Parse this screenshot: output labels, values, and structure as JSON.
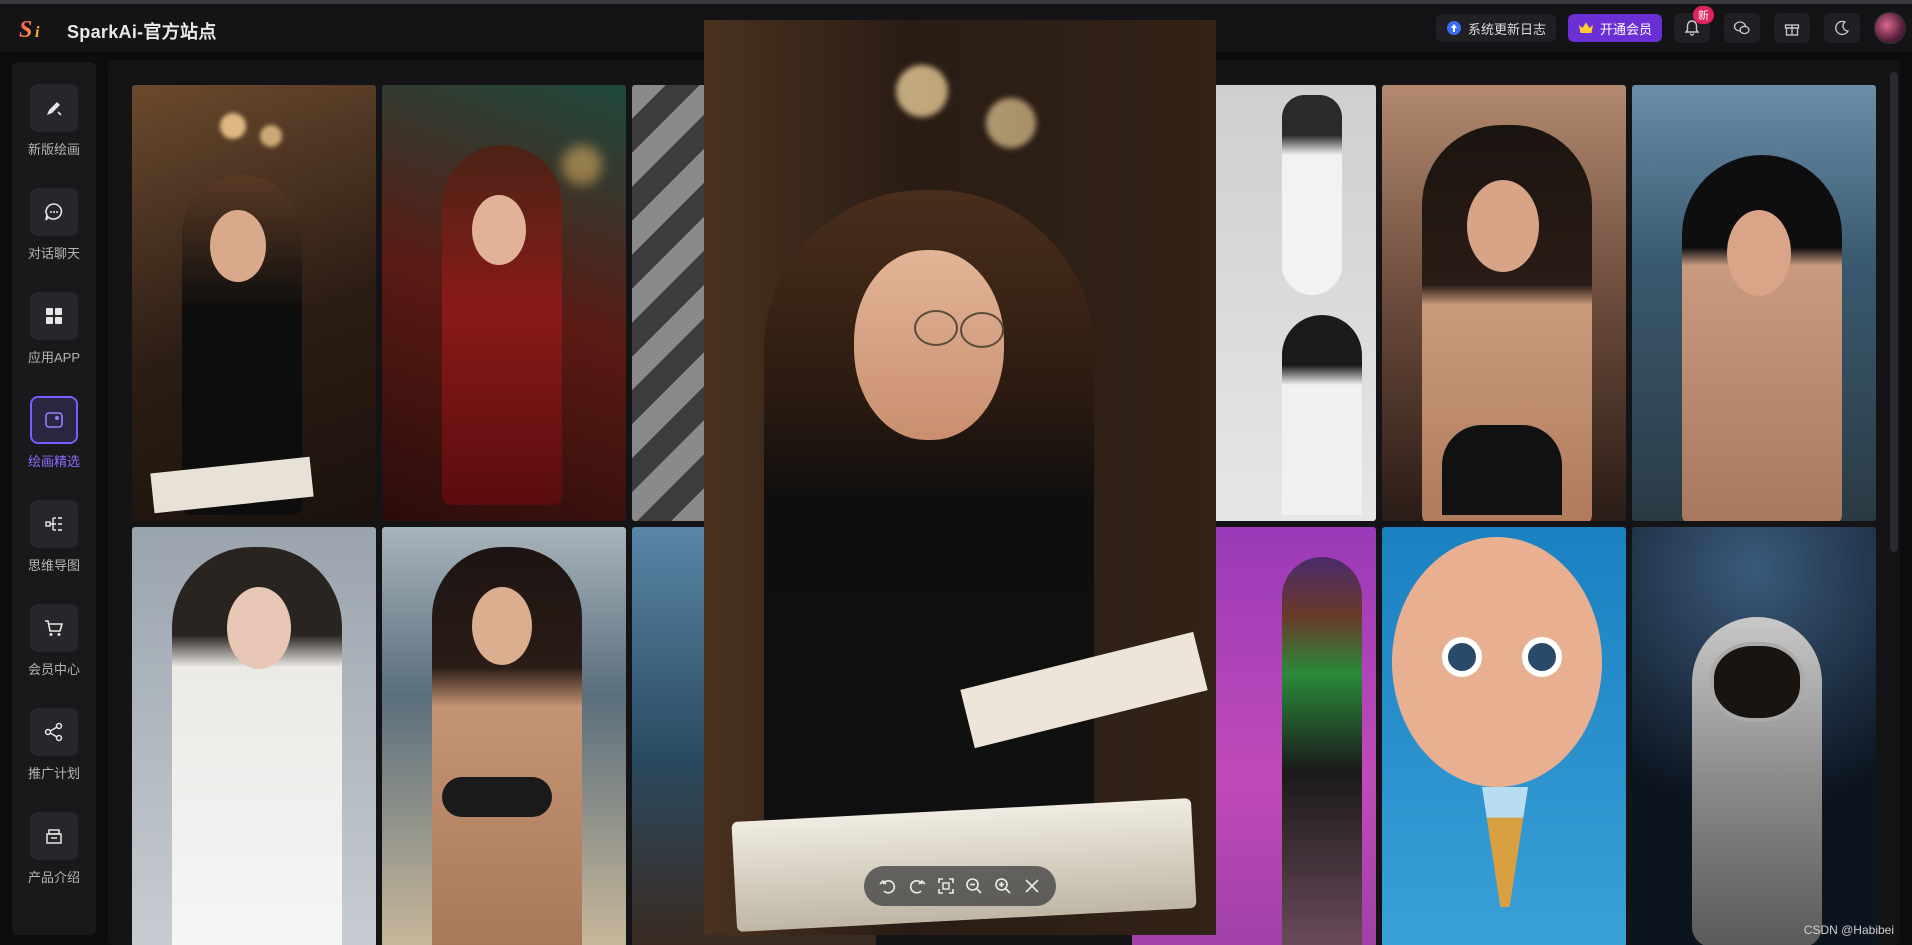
{
  "header": {
    "title": "SparkAi-官方站点",
    "changelog_label": "系统更新日志",
    "vip_label": "开通会员",
    "notify_badge": "新",
    "accent": "#6b2fd6"
  },
  "sidebar": {
    "items": [
      {
        "label": "新版绘画",
        "icon": "brush-icon"
      },
      {
        "label": "对话聊天",
        "icon": "chat-icon"
      },
      {
        "label": "应用APP",
        "icon": "grid-icon"
      },
      {
        "label": "绘画精选",
        "icon": "gallery-icon",
        "active": true
      },
      {
        "label": "思维导图",
        "icon": "mindmap-icon"
      },
      {
        "label": "会员中心",
        "icon": "cart-icon"
      },
      {
        "label": "推广计划",
        "icon": "share-icon"
      },
      {
        "label": "产品介绍",
        "icon": "product-icon"
      }
    ],
    "active_color": "#8d6bff"
  },
  "gallery": {
    "tiles": [
      {
        "subject": "woman-reading-cafe"
      },
      {
        "subject": "woman-red-dress-christmas"
      },
      {
        "subject": "woman-shadow-wall"
      },
      {
        "subject": "woman-white-gown"
      },
      {
        "subject": "woman-beach-sunset"
      },
      {
        "subject": "woman-ocean-portrait"
      },
      {
        "subject": "woman-white-lace"
      },
      {
        "subject": "woman-beach-bikini"
      },
      {
        "subject": "coastal-pier-umbrella"
      },
      {
        "subject": "cartoon-girl-purple"
      },
      {
        "subject": "cartoon-girl-ice-cream"
      },
      {
        "subject": "astronaut-moon"
      }
    ]
  },
  "viewer": {
    "subject": "woman-reading-cafe-enlarged",
    "tools": [
      "rotate-left-icon",
      "rotate-right-icon",
      "fit-screen-icon",
      "zoom-out-icon",
      "zoom-in-icon",
      "close-icon"
    ]
  },
  "watermark": "CSDN @Habibei"
}
